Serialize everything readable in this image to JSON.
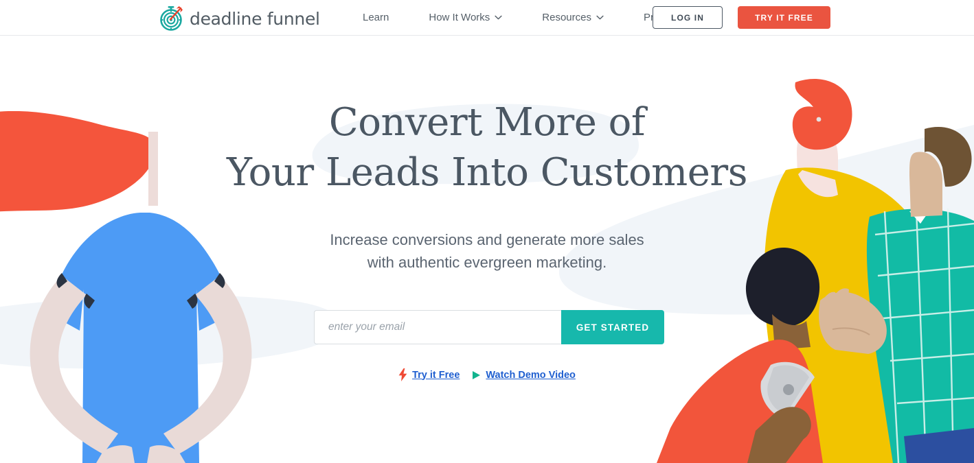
{
  "header": {
    "logo": {
      "icon": "stopwatch-target-icon",
      "text": "deadline funnel"
    },
    "nav": [
      {
        "label": "Learn",
        "has_dropdown": false,
        "icon": null
      },
      {
        "label": "How It Works",
        "has_dropdown": true,
        "icon": "chevron-down-icon"
      },
      {
        "label": "Resources",
        "has_dropdown": true,
        "icon": "chevron-down-icon"
      },
      {
        "label": "Pricing",
        "has_dropdown": false,
        "icon": null
      }
    ],
    "login_label": "LOG IN",
    "try_free_label": "TRY IT FREE"
  },
  "hero": {
    "headline_line1": "Convert More of",
    "headline_line2": "Your Leads Into Customers",
    "subhead_line1": "Increase conversions and generate more sales",
    "subhead_line2": "with authentic evergreen marketing.",
    "email_placeholder": "enter your email",
    "email_value": "",
    "cta_label": "GET STARTED",
    "links": [
      {
        "label": "Try it Free",
        "icon": "lightning-bolt-icon"
      },
      {
        "label": "Watch Demo Video",
        "icon": "play-triangle-icon"
      }
    ]
  },
  "colors": {
    "accent_red": "#ea5440",
    "accent_teal": "#17b8ac",
    "link_blue": "#1f5fd0",
    "text_slate": "#4b5763",
    "blob_light": "#f1f5f9",
    "illo_blue": "#4d9bf5",
    "illo_yellow": "#f2c400",
    "illo_skin_pale": "#f2dedc",
    "illo_skin_brown": "#8a6239",
    "illo_hair_dark": "#1d1f2b",
    "illo_hair_brown": "#6e5334",
    "illo_teal_shirt": "#12bba5",
    "illo_navy": "#2c4fa0"
  }
}
